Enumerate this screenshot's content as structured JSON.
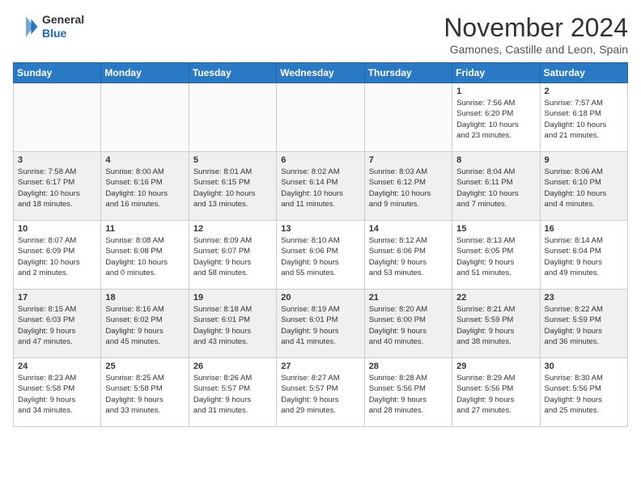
{
  "header": {
    "logo_line1": "General",
    "logo_line2": "Blue",
    "month_title": "November 2024",
    "location": "Gamones, Castille and Leon, Spain"
  },
  "weekdays": [
    "Sunday",
    "Monday",
    "Tuesday",
    "Wednesday",
    "Thursday",
    "Friday",
    "Saturday"
  ],
  "weeks": [
    [
      {
        "day": "",
        "info": ""
      },
      {
        "day": "",
        "info": ""
      },
      {
        "day": "",
        "info": ""
      },
      {
        "day": "",
        "info": ""
      },
      {
        "day": "",
        "info": ""
      },
      {
        "day": "1",
        "info": "Sunrise: 7:56 AM\nSunset: 6:20 PM\nDaylight: 10 hours\nand 23 minutes."
      },
      {
        "day": "2",
        "info": "Sunrise: 7:57 AM\nSunset: 6:18 PM\nDaylight: 10 hours\nand 21 minutes."
      }
    ],
    [
      {
        "day": "3",
        "info": "Sunrise: 7:58 AM\nSunset: 6:17 PM\nDaylight: 10 hours\nand 18 minutes."
      },
      {
        "day": "4",
        "info": "Sunrise: 8:00 AM\nSunset: 6:16 PM\nDaylight: 10 hours\nand 16 minutes."
      },
      {
        "day": "5",
        "info": "Sunrise: 8:01 AM\nSunset: 6:15 PM\nDaylight: 10 hours\nand 13 minutes."
      },
      {
        "day": "6",
        "info": "Sunrise: 8:02 AM\nSunset: 6:14 PM\nDaylight: 10 hours\nand 11 minutes."
      },
      {
        "day": "7",
        "info": "Sunrise: 8:03 AM\nSunset: 6:12 PM\nDaylight: 10 hours\nand 9 minutes."
      },
      {
        "day": "8",
        "info": "Sunrise: 8:04 AM\nSunset: 6:11 PM\nDaylight: 10 hours\nand 7 minutes."
      },
      {
        "day": "9",
        "info": "Sunrise: 8:06 AM\nSunset: 6:10 PM\nDaylight: 10 hours\nand 4 minutes."
      }
    ],
    [
      {
        "day": "10",
        "info": "Sunrise: 8:07 AM\nSunset: 6:09 PM\nDaylight: 10 hours\nand 2 minutes."
      },
      {
        "day": "11",
        "info": "Sunrise: 8:08 AM\nSunset: 6:08 PM\nDaylight: 10 hours\nand 0 minutes."
      },
      {
        "day": "12",
        "info": "Sunrise: 8:09 AM\nSunset: 6:07 PM\nDaylight: 9 hours\nand 58 minutes."
      },
      {
        "day": "13",
        "info": "Sunrise: 8:10 AM\nSunset: 6:06 PM\nDaylight: 9 hours\nand 55 minutes."
      },
      {
        "day": "14",
        "info": "Sunrise: 8:12 AM\nSunset: 6:06 PM\nDaylight: 9 hours\nand 53 minutes."
      },
      {
        "day": "15",
        "info": "Sunrise: 8:13 AM\nSunset: 6:05 PM\nDaylight: 9 hours\nand 51 minutes."
      },
      {
        "day": "16",
        "info": "Sunrise: 8:14 AM\nSunset: 6:04 PM\nDaylight: 9 hours\nand 49 minutes."
      }
    ],
    [
      {
        "day": "17",
        "info": "Sunrise: 8:15 AM\nSunset: 6:03 PM\nDaylight: 9 hours\nand 47 minutes."
      },
      {
        "day": "18",
        "info": "Sunrise: 8:16 AM\nSunset: 6:02 PM\nDaylight: 9 hours\nand 45 minutes."
      },
      {
        "day": "19",
        "info": "Sunrise: 8:18 AM\nSunset: 6:01 PM\nDaylight: 9 hours\nand 43 minutes."
      },
      {
        "day": "20",
        "info": "Sunrise: 8:19 AM\nSunset: 6:01 PM\nDaylight: 9 hours\nand 41 minutes."
      },
      {
        "day": "21",
        "info": "Sunrise: 8:20 AM\nSunset: 6:00 PM\nDaylight: 9 hours\nand 40 minutes."
      },
      {
        "day": "22",
        "info": "Sunrise: 8:21 AM\nSunset: 5:59 PM\nDaylight: 9 hours\nand 38 minutes."
      },
      {
        "day": "23",
        "info": "Sunrise: 8:22 AM\nSunset: 5:59 PM\nDaylight: 9 hours\nand 36 minutes."
      }
    ],
    [
      {
        "day": "24",
        "info": "Sunrise: 8:23 AM\nSunset: 5:58 PM\nDaylight: 9 hours\nand 34 minutes."
      },
      {
        "day": "25",
        "info": "Sunrise: 8:25 AM\nSunset: 5:58 PM\nDaylight: 9 hours\nand 33 minutes."
      },
      {
        "day": "26",
        "info": "Sunrise: 8:26 AM\nSunset: 5:57 PM\nDaylight: 9 hours\nand 31 minutes."
      },
      {
        "day": "27",
        "info": "Sunrise: 8:27 AM\nSunset: 5:57 PM\nDaylight: 9 hours\nand 29 minutes."
      },
      {
        "day": "28",
        "info": "Sunrise: 8:28 AM\nSunset: 5:56 PM\nDaylight: 9 hours\nand 28 minutes."
      },
      {
        "day": "29",
        "info": "Sunrise: 8:29 AM\nSunset: 5:56 PM\nDaylight: 9 hours\nand 27 minutes."
      },
      {
        "day": "30",
        "info": "Sunrise: 8:30 AM\nSunset: 5:56 PM\nDaylight: 9 hours\nand 25 minutes."
      }
    ]
  ]
}
